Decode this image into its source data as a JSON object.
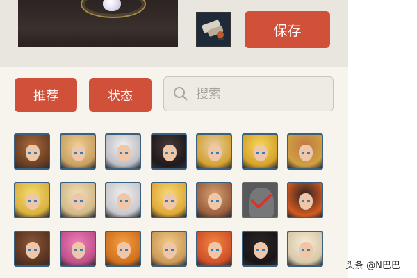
{
  "toolbar": {
    "save_label": "保存"
  },
  "filters": {
    "recommend_label": "推荐",
    "status_label": "状态"
  },
  "search": {
    "placeholder": "搜索",
    "value": ""
  },
  "colors": {
    "accent": "#d1503a",
    "panel_bg": "#f7f4ee",
    "portrait_border": "#3a6080"
  },
  "portraits": {
    "rows": 3,
    "columns": 7,
    "locked_cell": {
      "row": 2,
      "column": 6,
      "icon": "checkmark-icon"
    }
  },
  "watermark": {
    "text": "头条 @N巴巴"
  }
}
